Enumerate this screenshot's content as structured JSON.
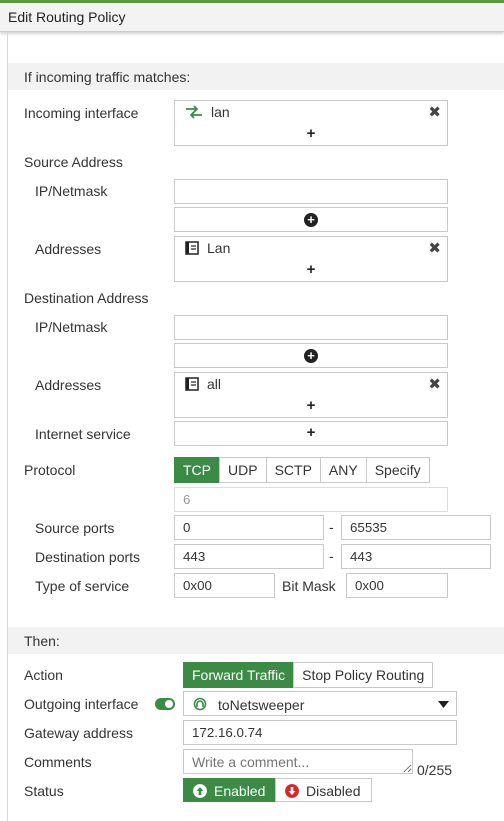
{
  "window": {
    "title": "Edit Routing Policy"
  },
  "match_section": {
    "title": "If incoming traffic matches:"
  },
  "incoming_interface": {
    "label": "Incoming interface",
    "value": "lan",
    "icon": "swap-arrows-icon"
  },
  "source": {
    "label": "Source Address",
    "ip_label": "IP/Netmask",
    "ip_value": "",
    "addresses_label": "Addresses",
    "address_value": "Lan",
    "address_icon": "address-book-icon"
  },
  "destination": {
    "label": "Destination Address",
    "ip_label": "IP/Netmask",
    "ip_value": "",
    "addresses_label": "Addresses",
    "address_value": "all",
    "address_icon": "address-book-icon",
    "internet_service_label": "Internet service"
  },
  "protocol": {
    "label": "Protocol",
    "options": [
      "TCP",
      "UDP",
      "SCTP",
      "ANY",
      "Specify"
    ],
    "selected": "TCP",
    "number": "6"
  },
  "ports": {
    "source_label": "Source ports",
    "source_from": "0",
    "source_to": "65535",
    "dest_label": "Destination ports",
    "dest_from": "443",
    "dest_to": "443",
    "separator": "-"
  },
  "tos": {
    "label": "Type of service",
    "value": "0x00",
    "mask_label": "Bit Mask",
    "mask_value": "0x00"
  },
  "then_section": {
    "title": "Then:"
  },
  "action": {
    "label": "Action",
    "options": [
      "Forward Traffic",
      "Stop Policy Routing"
    ],
    "selected": "Forward Traffic"
  },
  "outgoing": {
    "label": "Outgoing interface",
    "enabled": true,
    "value": "toNetsweeper",
    "icon": "tunnel-icon"
  },
  "gateway": {
    "label": "Gateway address",
    "value": "172.16.0.74"
  },
  "comments": {
    "label": "Comments",
    "placeholder": "Write a comment...",
    "counter": "0/255"
  },
  "status": {
    "label": "Status",
    "enabled_label": "Enabled",
    "disabled_label": "Disabled",
    "selected": "Enabled"
  },
  "colors": {
    "accent": "#3b8b46",
    "section_bg": "#f2f2f2",
    "border": "#c9c9c9",
    "disabled_red": "#d9262c"
  }
}
